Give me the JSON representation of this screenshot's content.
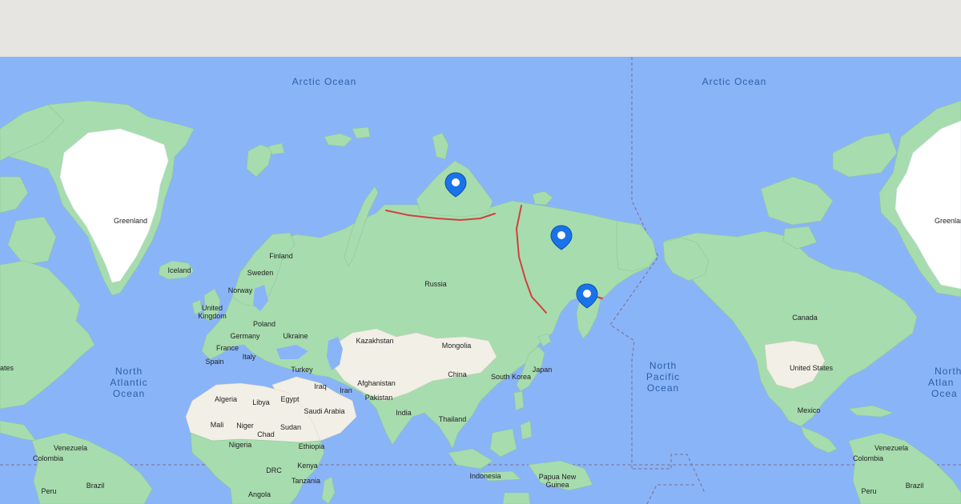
{
  "colors": {
    "water": "#8ab4f8",
    "land": "#a7dcae",
    "desert": "#f2efe6",
    "ice": "#ffffff",
    "route": "#d2403e",
    "marker": "#1a73e8",
    "topbar": "#e6e5e1"
  },
  "oceans": {
    "arctic_left": "Arctic Ocean",
    "arctic_right": "Arctic Ocean",
    "north_atlantic_left": [
      "North",
      "Atlantic",
      "Ocean"
    ],
    "north_pacific": [
      "North",
      "Pacific",
      "Ocean"
    ],
    "north_atlantic_right": [
      "North",
      "Atlan",
      "Ocea"
    ]
  },
  "labels": {
    "greenland_left": "Greenland",
    "greenland_right": "Greenlan",
    "iceland": "Iceland",
    "finland": "Finland",
    "sweden": "Sweden",
    "norway": "Norway",
    "united_kingdom": [
      "United",
      "Kingdom"
    ],
    "poland": "Poland",
    "germany": "Germany",
    "ukraine": "Ukraine",
    "france": "France",
    "italy": "Italy",
    "spain": "Spain",
    "turkey": "Turkey",
    "russia": "Russia",
    "kazakhstan": "Kazakhstan",
    "mongolia": "Mongolia",
    "china": "China",
    "south_korea": "South Korea",
    "japan": "Japan",
    "iraq": "Iraq",
    "iran": "Iran",
    "afghanistan": "Afghanistan",
    "pakistan": "Pakistan",
    "saudi_arabia": "Saudi Arabia",
    "india": "India",
    "thailand": "Thailand",
    "indonesia": "Indonesia",
    "papua_new_guinea": [
      "Papua New",
      "Guinea"
    ],
    "algeria": "Algeria",
    "libya": "Libya",
    "egypt": "Egypt",
    "mali": "Mali",
    "niger": "Niger",
    "chad": "Chad",
    "sudan": "Sudan",
    "nigeria": "Nigeria",
    "ethiopia": "Ethiopia",
    "drc": "DRC",
    "kenya": "Kenya",
    "tanzania": "Tanzania",
    "angola": "Angola",
    "venezuela_left": "Venezuela",
    "colombia_left": "Colombia",
    "peru_left": "Peru",
    "brazil_left": "Brazil",
    "states_left": "ates",
    "canada": "Canada",
    "united_states": "United States",
    "mexico": "Mexico",
    "venezuela_right": "Venezuela",
    "colombia_right": "Colombia",
    "peru_right": "Peru",
    "brazil_right": "Brazil"
  },
  "markers": [
    {
      "name": "marker-novaya-zemlya"
    },
    {
      "name": "marker-yakutia"
    },
    {
      "name": "marker-kamchatka"
    }
  ]
}
